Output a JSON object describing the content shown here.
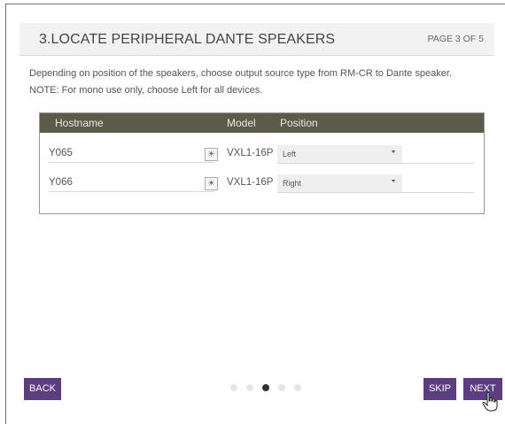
{
  "header": {
    "title": "3.LOCATE PERIPHERAL DANTE SPEAKERS",
    "page_indicator": "PAGE 3 OF 5"
  },
  "description": {
    "line1": "Depending on position of the speakers, choose output source type from RM-CR to Dante speaker.",
    "line2": "NOTE: For mono use only, choose Left for all devices."
  },
  "table": {
    "columns": {
      "hostname": "Hostname",
      "model": "Model",
      "position": "Position"
    },
    "rows": [
      {
        "hostname": "Y065",
        "icon": "sun-icon",
        "model": "VXL1-16P",
        "position": "Left"
      },
      {
        "hostname": "Y066",
        "icon": "sun-icon",
        "model": "VXL1-16P",
        "position": "Right"
      }
    ]
  },
  "footer": {
    "back_label": "BACK",
    "skip_label": "SKIP",
    "next_label": "NEXT",
    "pager": {
      "total": 5,
      "current": 3
    }
  },
  "colors": {
    "accent": "#5c3d82",
    "table_header": "#5c5a48",
    "header_bg": "#f2f2f2"
  }
}
